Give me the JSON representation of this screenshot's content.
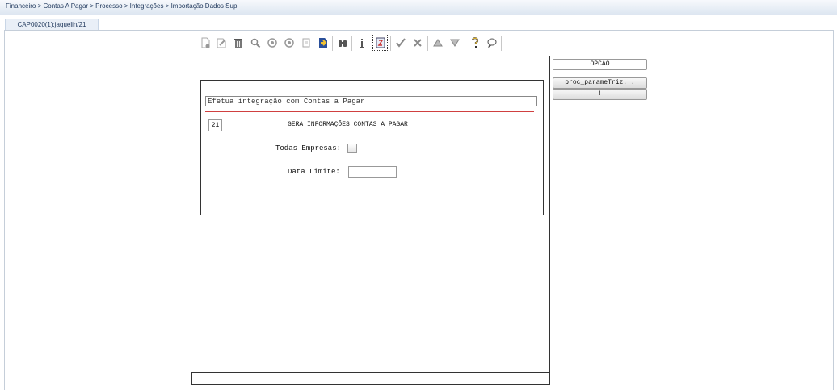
{
  "header": {
    "breadcrumb": "Financeiro > Contas A Pagar > Processo > Integrações > Importação Dados Sup"
  },
  "tabs": [
    {
      "label": "CAP0020(1):jaquelin/21"
    }
  ],
  "toolbar": {
    "icons": [
      "new-icon",
      "edit-icon",
      "delete-icon",
      "search-icon",
      "previous-icon",
      "next-icon",
      "copy-icon",
      "navigate-icon",
      "find-icon",
      "info-icon",
      "zoom-icon",
      "confirm-icon",
      "cancel-icon",
      "up-icon",
      "down-icon",
      "help-icon",
      "comment-icon"
    ]
  },
  "form": {
    "title": "Efetua integração com Contas a Pagar",
    "program_number": "21",
    "heading": "GERA INFORMAÇÕES CONTAS A PAGAR",
    "todas_empresas_label": "Todas Empresas:",
    "todas_empresas_checked": false,
    "data_limite_label": "Data Limite:",
    "data_limite_value": ""
  },
  "side_buttons": {
    "opcao": "OPCAO",
    "proc": "proc_parameTriz...",
    "bang": "!"
  }
}
